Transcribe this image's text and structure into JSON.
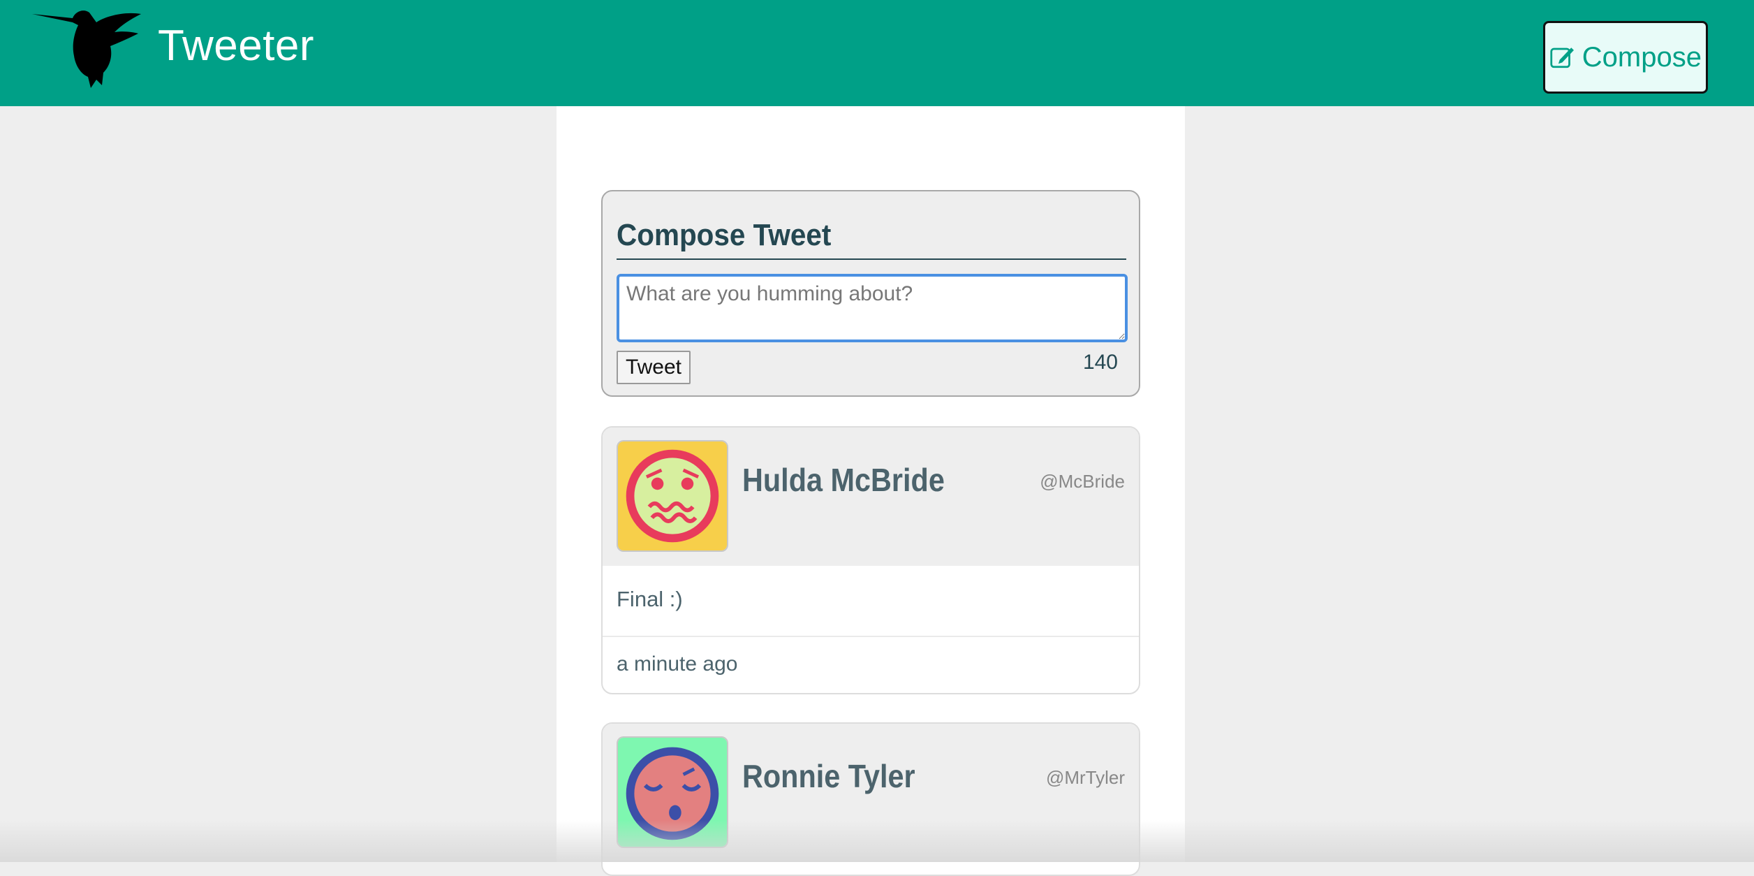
{
  "nav": {
    "brand": "Tweeter",
    "logo_icon": "hummingbird-icon",
    "compose_label": "Compose",
    "compose_icon": "edit-icon",
    "bg_color": "#00a087"
  },
  "composer": {
    "title": "Compose Tweet",
    "placeholder": "What are you humming about?",
    "value": "",
    "submit_label": "Tweet",
    "counter": "140"
  },
  "tweets": [
    {
      "name": "Hulda McBride",
      "handle": "@McBride",
      "text": "Final :)",
      "time": "a minute ago",
      "avatar_icon": "nauseated-face-icon"
    },
    {
      "name": "Ronnie Tyler",
      "handle": "@MrTyler",
      "avatar_icon": "sleeping-face-icon"
    }
  ]
}
